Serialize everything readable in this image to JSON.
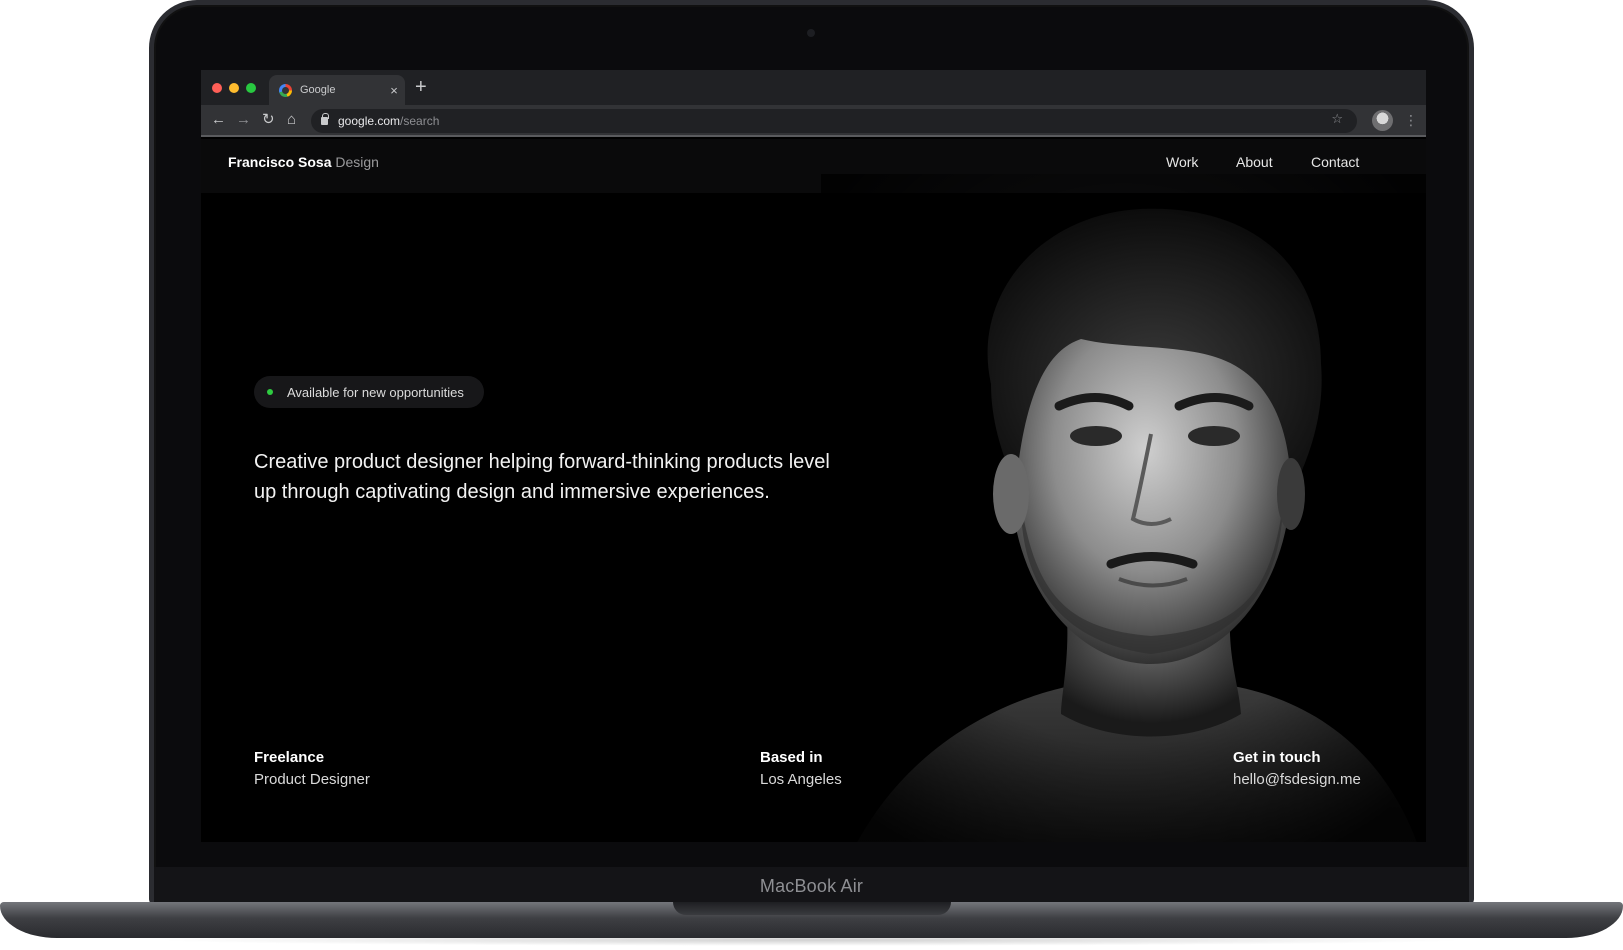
{
  "device": {
    "label": "MacBook Air"
  },
  "browser": {
    "tab": {
      "title": "Google",
      "close": "×"
    },
    "new_tab": "+",
    "nav": {
      "back": "←",
      "forward": "→",
      "reload": "↻",
      "home": "⌂"
    },
    "url": {
      "host": "google.com",
      "path": "/search"
    },
    "bookmark": "☆",
    "menu": "⋮",
    "traffic_lights": [
      "#ff5f57",
      "#febc2e",
      "#28c840"
    ]
  },
  "site": {
    "brand": {
      "name": "Francisco Sosa",
      "suffix": "Design"
    },
    "nav": [
      {
        "label": "Work"
      },
      {
        "label": "About"
      },
      {
        "label": "Contact"
      }
    ],
    "status": {
      "text": "Available for new opportunities",
      "color": "#2ecc40"
    },
    "headline": "Creative product designer helping forward-thinking products level up through captivating design and immersive experiences.",
    "details": [
      {
        "label": "Freelance",
        "value": "Product Designer"
      },
      {
        "label": "Based in",
        "value": "Los Angeles"
      },
      {
        "label": "Get in touch",
        "value": "hello@fsdesign.me"
      }
    ]
  }
}
